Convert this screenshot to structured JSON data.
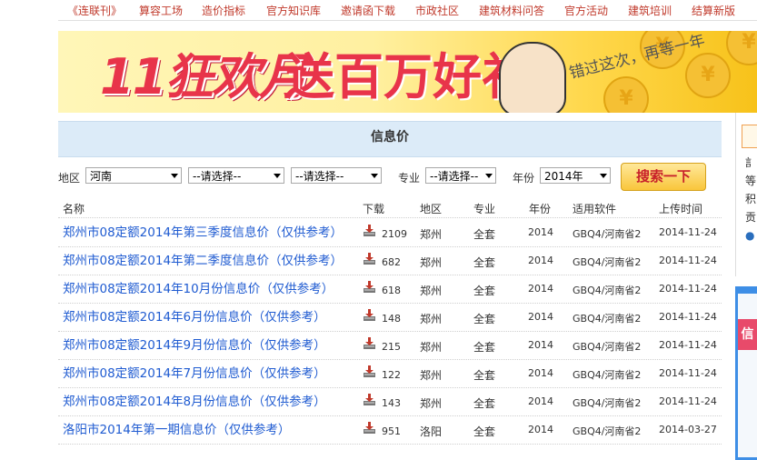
{
  "nav": {
    "items": [
      "《连联刊》",
      "算容工场",
      "造价指标",
      "官方知识库",
      "邀请函下载",
      "市政社区",
      "建筑材料问答",
      "官方活动",
      "建筑培训",
      "结算新版"
    ]
  },
  "banner": {
    "title": "11狂欢月",
    "subtitle": "送百万好礼",
    "slogan": "错过这次，再等一年"
  },
  "page": {
    "heading": "信息价"
  },
  "filters": {
    "region_label": "地区",
    "region_value": "河南",
    "select2_value": "--请选择--",
    "select3_value": "--请选择--",
    "major_label": "专业",
    "major_value": "--请选择--",
    "year_label": "年份",
    "year_value": "2014年",
    "search_button": "搜索一下"
  },
  "table": {
    "headers": [
      "名称",
      "下载",
      "地区",
      "专业",
      "年份",
      "适用软件",
      "上传时间"
    ],
    "rows": [
      {
        "name": "郑州市08定额2014年第三季度信息价（仅供参考）",
        "downloads": "2109",
        "region": "郑州",
        "major": "全套",
        "year": "2014",
        "software": "GBQ4/河南省2",
        "date": "2014-11-24"
      },
      {
        "name": "郑州市08定额2014年第二季度信息价（仅供参考）",
        "downloads": "682",
        "region": "郑州",
        "major": "全套",
        "year": "2014",
        "software": "GBQ4/河南省2",
        "date": "2014-11-24"
      },
      {
        "name": "郑州市08定额2014年10月份信息价（仅供参考）",
        "downloads": "618",
        "region": "郑州",
        "major": "全套",
        "year": "2014",
        "software": "GBQ4/河南省2",
        "date": "2014-11-24"
      },
      {
        "name": "郑州市08定额2014年6月份信息价（仅供参考）",
        "downloads": "148",
        "region": "郑州",
        "major": "全套",
        "year": "2014",
        "software": "GBQ4/河南省2",
        "date": "2014-11-24"
      },
      {
        "name": "郑州市08定额2014年9月份信息价（仅供参考）",
        "downloads": "215",
        "region": "郑州",
        "major": "全套",
        "year": "2014",
        "software": "GBQ4/河南省2",
        "date": "2014-11-24"
      },
      {
        "name": "郑州市08定额2014年7月份信息价（仅供参考）",
        "downloads": "122",
        "region": "郑州",
        "major": "全套",
        "year": "2014",
        "software": "GBQ4/河南省2",
        "date": "2014-11-24"
      },
      {
        "name": "郑州市08定额2014年8月份信息价（仅供参考）",
        "downloads": "143",
        "region": "郑州",
        "major": "全套",
        "year": "2014",
        "software": "GBQ4/河南省2",
        "date": "2014-11-24"
      },
      {
        "name": "洛阳市2014年第一期信息价（仅供参考）",
        "downloads": "951",
        "region": "洛阳",
        "major": "全套",
        "year": "2014",
        "software": "GBQ4/河南省2",
        "date": "2014-03-27"
      }
    ]
  },
  "sidebar": {
    "lines": [
      "訁",
      "等",
      "积",
      "贡"
    ],
    "ribbon": "信"
  },
  "colors": {
    "nav_text": "#c0392b",
    "link": "#1f5bd1",
    "header_bar": "#dcebf8",
    "banner_red": "#e8344a",
    "search_text": "#c8202a"
  }
}
